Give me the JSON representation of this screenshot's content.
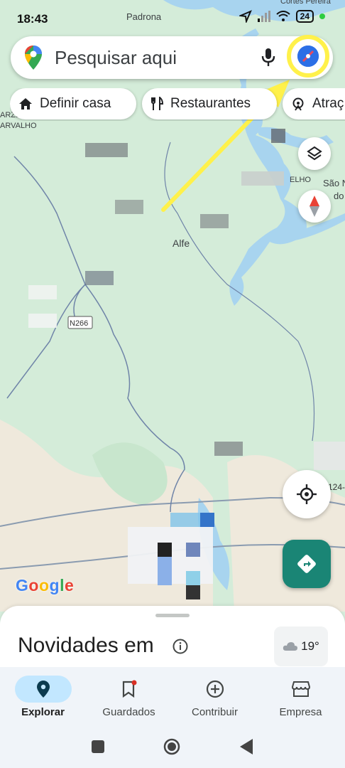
{
  "status_bar": {
    "time": "18:43",
    "battery": "24"
  },
  "search": {
    "placeholder": "Pesquisar aqui"
  },
  "chips": [
    {
      "label": "Definir casa",
      "icon": "home-icon"
    },
    {
      "label": "Restaurantes",
      "icon": "fork-knife-icon"
    },
    {
      "label": "Atraç",
      "icon": "attraction-icon"
    }
  ],
  "map": {
    "places": [
      "Padrona",
      "Cortes Pereira",
      "ARZE",
      "ARVALHO",
      "ELHO",
      "São N",
      "do",
      "Alfe",
      "N266",
      "124-"
    ],
    "attribution": "Google"
  },
  "sheet": {
    "title": "Novidades em",
    "temperature": "19°"
  },
  "bottom_nav": [
    {
      "label": "Explorar",
      "icon": "explore-pin-icon",
      "active": true
    },
    {
      "label": "Guardados",
      "icon": "bookmark-icon",
      "active": false
    },
    {
      "label": "Contribuir",
      "icon": "add-circle-icon",
      "active": false
    },
    {
      "label": "Empresa",
      "icon": "storefront-icon",
      "active": false
    }
  ],
  "colors": {
    "accent_teal": "#1a8575",
    "highlight_yellow": "#fff14a",
    "nav_active": "#c2e7ff",
    "map_green": "#d7eedd",
    "water": "#a8d4ef"
  }
}
